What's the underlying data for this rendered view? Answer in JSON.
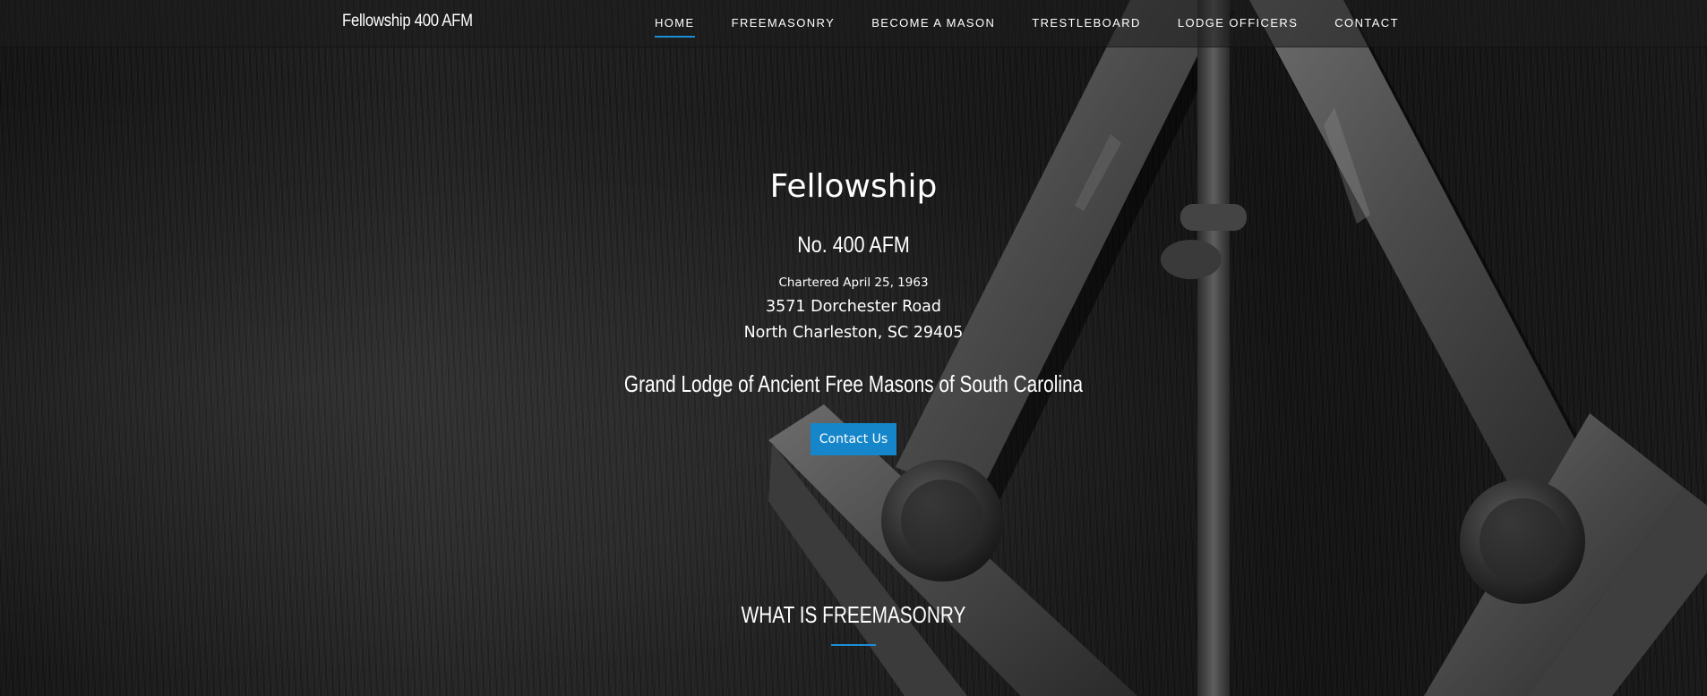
{
  "site": {
    "brand": "Fellowship 400 AFM"
  },
  "nav": {
    "items": [
      {
        "label": "HOME",
        "active": true
      },
      {
        "label": "FREEMASONRY",
        "active": false
      },
      {
        "label": "BECOME A MASON",
        "active": false
      },
      {
        "label": "TRESTLEBOARD",
        "active": false
      },
      {
        "label": "LODGE OFFICERS",
        "active": false
      },
      {
        "label": "CONTACT",
        "active": false
      }
    ]
  },
  "hero": {
    "title": "Fellowship",
    "number": "No. 400 AFM",
    "chartered": "Chartered April 25, 1963",
    "address_line1": "3571 Dorchester Road",
    "address_line2": "North Charleston, SC 29405",
    "grand_lodge": "Grand Lodge of Ancient Free Masons of South Carolina",
    "cta_label": "Contact Us"
  },
  "section": {
    "title": "WHAT IS FREEMASONRY"
  },
  "colors": {
    "accent": "#1a8fd6",
    "button": "#1586c9",
    "nav_bg": "#1e1e1e"
  },
  "background_icon": "square-and-compasses-icon"
}
